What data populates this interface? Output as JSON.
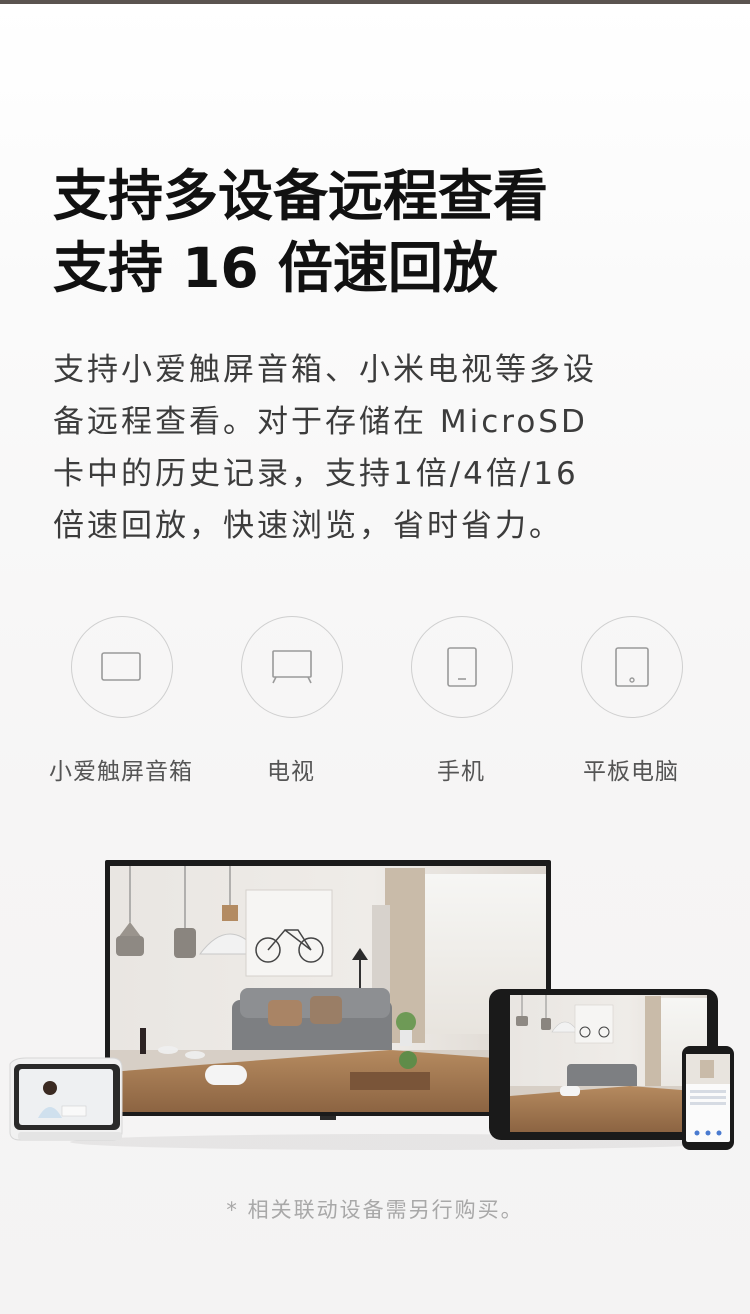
{
  "headline": {
    "line1": "支持多设备远程查看",
    "line2": "支持 16 倍速回放"
  },
  "description": {
    "lines": [
      "支持小爱触屏音箱、小米电视等多设",
      "备远程查看。对于存储在 MicroSD",
      "卡中的历史记录，支持1倍/4倍/16",
      "倍速回放，快速浏览，省时省力。"
    ]
  },
  "devices": [
    {
      "label": "小爱触屏音箱",
      "icon": "smart-speaker-icon"
    },
    {
      "label": "电视",
      "icon": "tv-icon"
    },
    {
      "label": "手机",
      "icon": "phone-icon"
    },
    {
      "label": "平板电脑",
      "icon": "tablet-icon"
    }
  ],
  "footnote": "* 相关联动设备需另行购买。",
  "colors": {
    "headline": "#111111",
    "body_text": "#3c3c3c",
    "icon_stroke": "#9a9a9a",
    "footnote": "#a8a8a8"
  }
}
